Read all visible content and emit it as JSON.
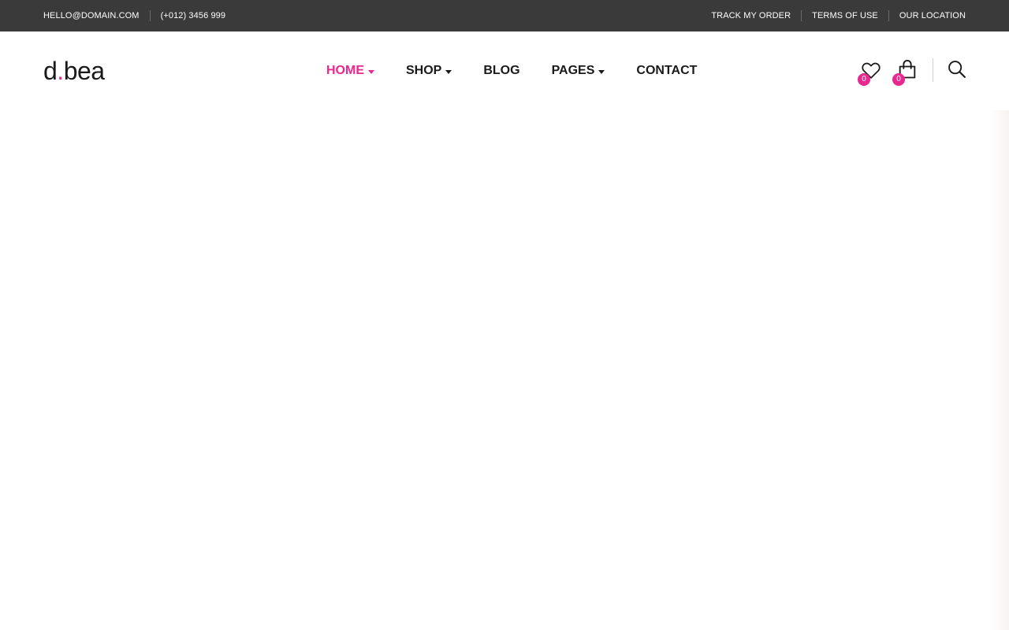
{
  "topbar": {
    "email": "HELLO@DOMAIN.COM",
    "phone": "(+012) 3456 999",
    "links": [
      "TRACK MY ORDER",
      "TERMS OF USE",
      "OUR LOCATION"
    ]
  },
  "header": {
    "logo": {
      "part1": "d",
      "dot": ".",
      "part2": "bea"
    },
    "nav": [
      {
        "label": "HOME",
        "has_dropdown": true,
        "active": true
      },
      {
        "label": "SHOP",
        "has_dropdown": true,
        "active": false
      },
      {
        "label": "BLOG",
        "has_dropdown": false,
        "active": false
      },
      {
        "label": "PAGES",
        "has_dropdown": true,
        "active": false
      },
      {
        "label": "CONTACT",
        "has_dropdown": false,
        "active": false
      }
    ],
    "wishlist": {
      "icon": "heart-icon",
      "count": "0"
    },
    "cart": {
      "icon": "shopping-bag-icon",
      "count": "0"
    },
    "search": {
      "icon": "search-icon"
    }
  },
  "colors": {
    "accent": "#e8288f",
    "topbar_bg": "#3a3a3a",
    "text_dark": "#1a1a1a"
  }
}
